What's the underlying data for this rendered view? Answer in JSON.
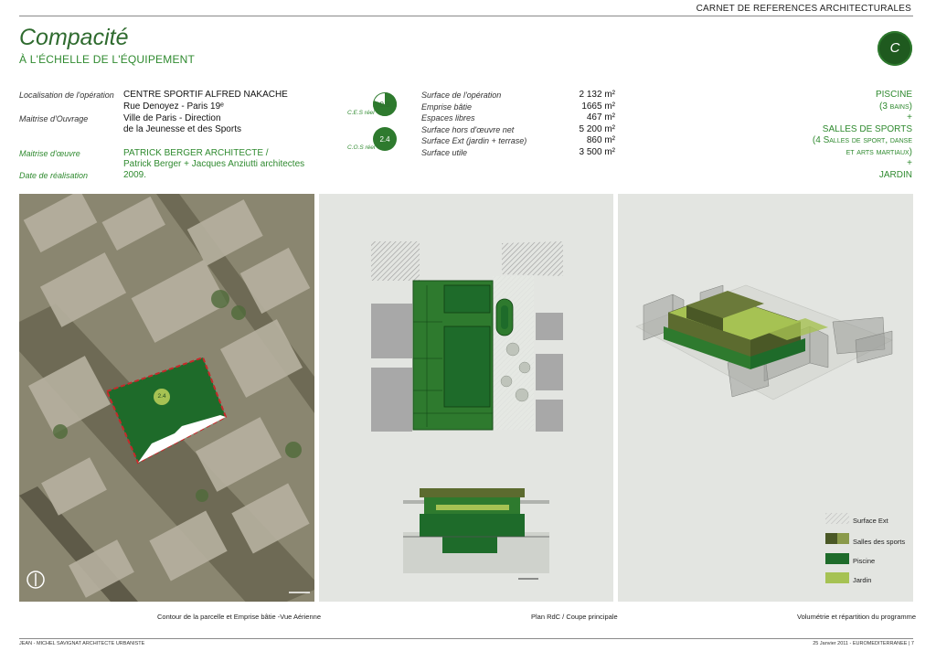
{
  "header": {
    "carnet": "CARNET DE REFERENCES ARCHITECTURALES",
    "title": "Compacité",
    "subtitle": "À L'ÉCHELLE DE L'ÉQUIPEMENT",
    "badge": "C"
  },
  "info": {
    "localisation_label": "Localisation de l'opération",
    "localisation_value1": "CENTRE SPORTIF ALFRED NAKACHE",
    "localisation_value2": "Rue Denoyez - Paris 19ᵉ",
    "moa_label": "Maitrise d'Ouvrage",
    "moa_value1": "Ville de Paris - Direction",
    "moa_value2": "de la Jeunesse et des Sports",
    "moe_label": "Maitrise d'œuvre",
    "moe_value1": "PATRICK BERGER ARCHITECTE /",
    "moe_value2": "Patrick Berger + Jacques Anziutti architectes",
    "date_label": "Date de réalisation",
    "date_value": "2009."
  },
  "indicators": {
    "ces_value": "0.8",
    "ces_fraction": 0.8,
    "ces_label": "C.E.S réel",
    "cos_value": "2.4",
    "cos_label": "C.O.S réel"
  },
  "surfaces": [
    {
      "label": "Surface de l'opération",
      "value": "2 132 m²"
    },
    {
      "label": "Emprise bâtie",
      "value": "1665 m²"
    },
    {
      "label": "Espaces libres",
      "value": "467 m²"
    },
    {
      "label": "Surface hors d'œuvre net",
      "value": "5 200 m²"
    },
    {
      "label": "Surface Ext (jardin + terrase)",
      "value": "860 m²"
    },
    {
      "label": "Surface utile",
      "value": "3 500 m²"
    }
  ],
  "program": {
    "l1": "PISCINE",
    "l2": "(3 bains)",
    "l3": "+",
    "l4": "SALLES DE SPORTS",
    "l5": "(4 Salles de sport, danse",
    "l6": "et arts martiaux)",
    "l7": "+",
    "l8": "JARDIN"
  },
  "aerial": {
    "parcel_label": "2.4"
  },
  "legend": {
    "item1": "Surface Ext",
    "item2": "Salles des sports",
    "item3": "Piscine",
    "item4": "Jardin"
  },
  "captions": {
    "c1": "Contour de la parcelle et Emprise bâtie -Vue Aérienne",
    "c2": "Plan RdC / Coupe principale",
    "c3": "Volumétrie et répartition du programme"
  },
  "footer": {
    "left": "JEAN - MICHEL SAVIGNAT ARCHITECTE URBANISTE",
    "right": "25 Janvier 2011  - EUROMEDITERRANEE  |   7"
  },
  "colors": {
    "accent": "#2f8a2f",
    "dark_green": "#1f5a1f",
    "piscine": "#2e7a2e",
    "jardin": "#a6c253",
    "salles": "#6b7a3a"
  }
}
